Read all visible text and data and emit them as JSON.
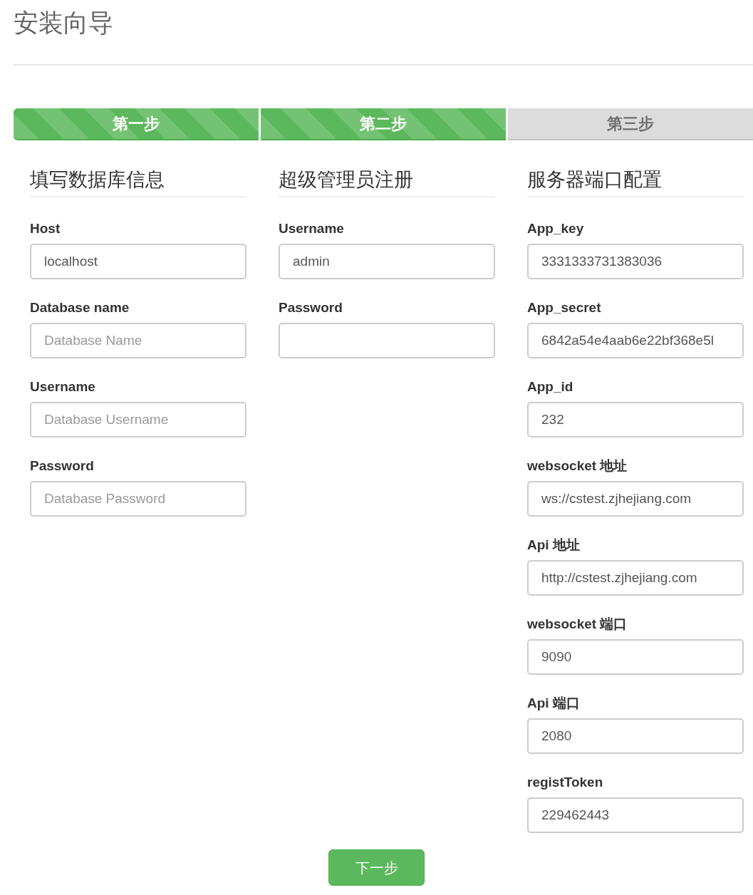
{
  "title": "安装向导",
  "steps": [
    {
      "label": "第一步",
      "completed": true
    },
    {
      "label": "第二步",
      "completed": true
    },
    {
      "label": "第三步",
      "completed": false
    }
  ],
  "sections": [
    {
      "heading": "填写数据库信息",
      "fields": [
        {
          "label": "Host",
          "value": "localhost"
        },
        {
          "label": "Database name",
          "placeholder": "Database Name"
        },
        {
          "label": "Username",
          "placeholder": "Database Username"
        },
        {
          "label": "Password",
          "placeholder": "Database Password"
        }
      ]
    },
    {
      "heading": "超级管理员注册",
      "fields": [
        {
          "label": "Username",
          "value": "admin"
        },
        {
          "label": "Password"
        }
      ]
    },
    {
      "heading": "服务器端口配置",
      "fields": [
        {
          "label": "App_key",
          "value": "3331333731383036"
        },
        {
          "label": "App_secret",
          "value": "6842a54e4aab6e22bf368e5l"
        },
        {
          "label": "App_id",
          "value": "232"
        },
        {
          "label": "websocket 地址",
          "value": "ws://cstest.zjhejiang.com"
        },
        {
          "label": "Api 地址",
          "value": "http://cstest.zjhejiang.com"
        },
        {
          "label": "websocket 端口",
          "value": "9090"
        },
        {
          "label": "Api 端口",
          "value": "2080"
        },
        {
          "label": "registToken",
          "value": "229462443"
        }
      ]
    }
  ],
  "next_button": "下一步"
}
